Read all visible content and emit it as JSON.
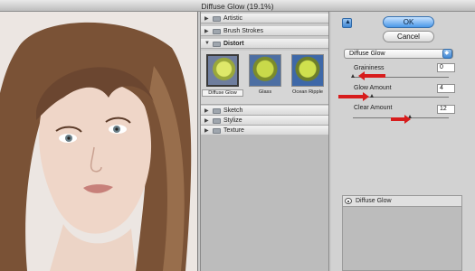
{
  "window": {
    "title": "Diffuse Glow (19.1%)"
  },
  "gallery": {
    "categories": [
      {
        "label": "Artistic",
        "expanded": false
      },
      {
        "label": "Brush Strokes",
        "expanded": false
      },
      {
        "label": "Distort",
        "expanded": true
      },
      {
        "label": "Sketch",
        "expanded": false
      },
      {
        "label": "Stylize",
        "expanded": false
      },
      {
        "label": "Texture",
        "expanded": false
      }
    ],
    "thumbnails": [
      {
        "label": "Diffuse Glow",
        "selected": true
      },
      {
        "label": "Glass",
        "selected": false
      },
      {
        "label": "Ocean Ripple",
        "selected": false
      }
    ]
  },
  "settings": {
    "ok_label": "OK",
    "cancel_label": "Cancel",
    "selected_filter": "Diffuse Glow",
    "params": [
      {
        "label": "Graininess",
        "value": "0",
        "slider_fraction": 0.0
      },
      {
        "label": "Glow Amount",
        "value": "4",
        "slider_fraction": 0.2
      },
      {
        "label": "Clear Amount",
        "value": "12",
        "slider_fraction": 0.6
      }
    ]
  },
  "layers": {
    "items": [
      {
        "label": "Diffuse Glow"
      }
    ]
  },
  "colors": {
    "accent_blue": "#4a98e8",
    "annotation_red": "#d71c1c"
  }
}
